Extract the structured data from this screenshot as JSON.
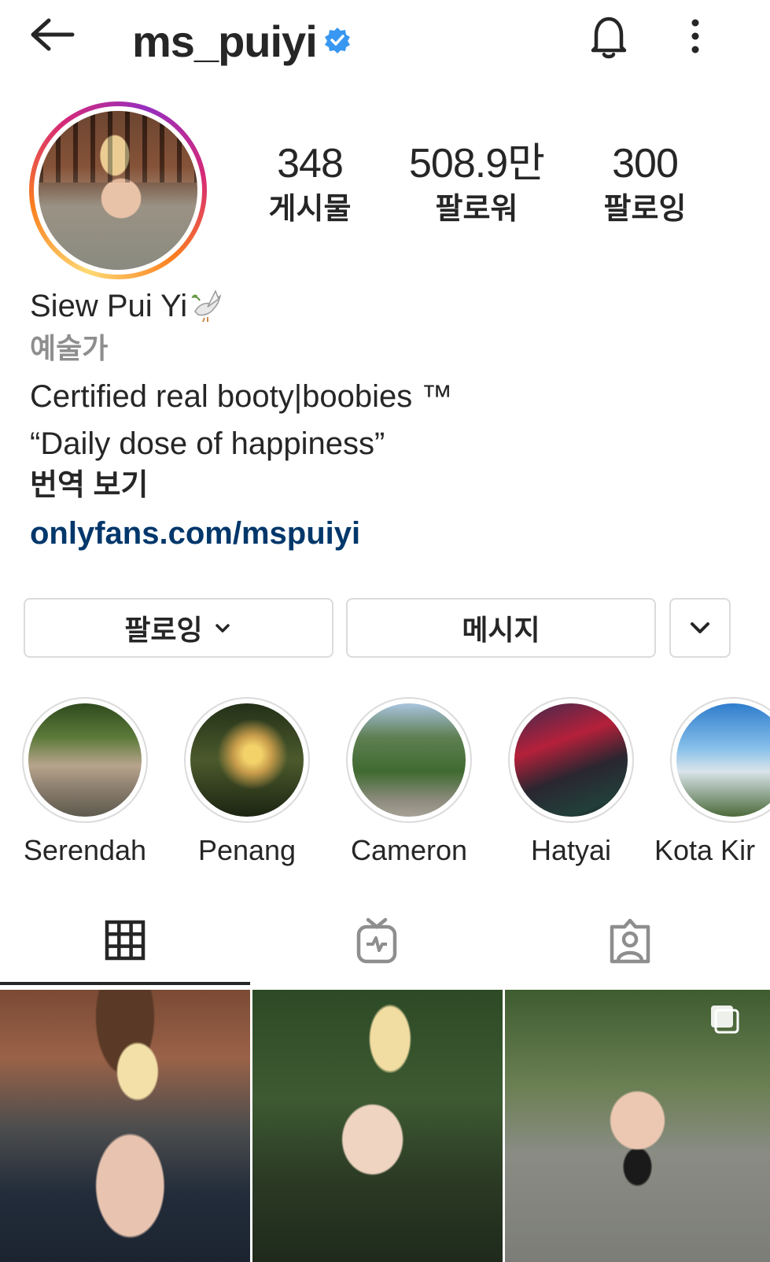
{
  "header": {
    "username": "ms_puiyi",
    "verified_color": "#3897f0"
  },
  "stats": [
    {
      "value": "348",
      "label": "게시물"
    },
    {
      "value": "508.9만",
      "label": "팔로워"
    },
    {
      "value": "300",
      "label": "팔로잉"
    }
  ],
  "bio": {
    "full_name": "Siew Pui Yi",
    "category": "예술가",
    "line1": "Certified real booty|boobies ™",
    "line2": "“Daily dose of happiness”",
    "translate": "번역 보기",
    "link": "onlyfans.com/mspuiyi",
    "link_color": "#00376b"
  },
  "actions": {
    "follow_label": "팔로잉",
    "message_label": "메시지"
  },
  "highlights": [
    {
      "name": "Serendah"
    },
    {
      "name": "Penang"
    },
    {
      "name": "Cameron"
    },
    {
      "name": "Hatyai"
    },
    {
      "name": "Kota Kir"
    }
  ],
  "tabs": [
    "grid-icon",
    "igtv-icon",
    "tagged-icon"
  ],
  "icons": {
    "back": "arrow-left-icon",
    "notifications": "bell-icon",
    "more": "vertical-dots-icon",
    "dropdown": "chevron-down-icon",
    "carousel": "carousel-icon"
  }
}
